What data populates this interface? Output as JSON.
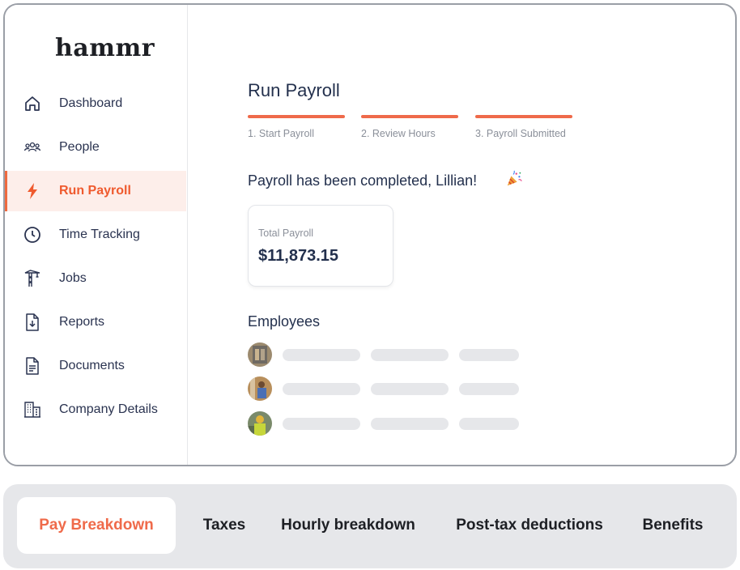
{
  "app": {
    "logo_text": "hammr"
  },
  "sidebar": {
    "items": [
      {
        "label": "Dashboard",
        "icon": "home-icon"
      },
      {
        "label": "People",
        "icon": "people-icon"
      },
      {
        "label": "Run Payroll",
        "icon": "lightning-icon",
        "active": true
      },
      {
        "label": "Time Tracking",
        "icon": "clock-icon"
      },
      {
        "label": "Jobs",
        "icon": "crane-icon"
      },
      {
        "label": "Reports",
        "icon": "report-download-icon"
      },
      {
        "label": "Documents",
        "icon": "document-icon"
      },
      {
        "label": "Company Details",
        "icon": "building-icon"
      }
    ]
  },
  "main": {
    "title": "Run Payroll",
    "steps": [
      {
        "label": "1. Start Payroll"
      },
      {
        "label": "2. Review Hours"
      },
      {
        "label": "3. Payroll Submitted"
      }
    ],
    "completion_message": "Payroll has been completed, Lillian!",
    "total_card": {
      "label": "Total Payroll",
      "value": "$11,873.15"
    },
    "employees_title": "Employees",
    "employees": [
      {
        "avatar": "employee-avatar-1"
      },
      {
        "avatar": "employee-avatar-2"
      },
      {
        "avatar": "employee-avatar-3"
      }
    ]
  },
  "tabs": [
    {
      "label": "Pay Breakdown",
      "active": true
    },
    {
      "label": "Taxes"
    },
    {
      "label": "Hourly breakdown"
    },
    {
      "label": "Post-tax deductions"
    },
    {
      "label": "Benefits"
    }
  ],
  "colors": {
    "accent": "#ef6a4a",
    "active_bg": "#fdeeea",
    "text": "#23304d",
    "muted": "#8a8f99"
  }
}
